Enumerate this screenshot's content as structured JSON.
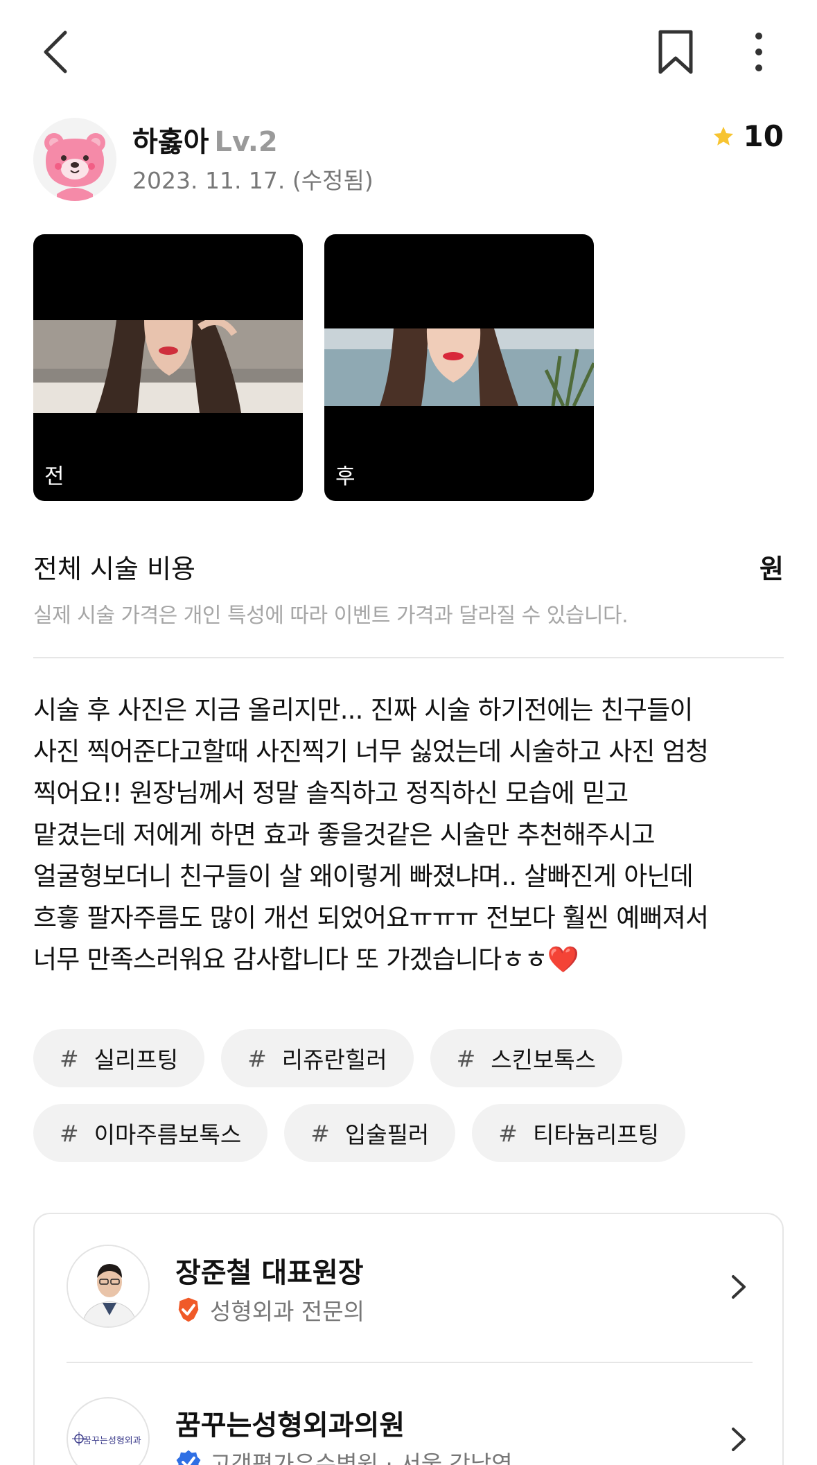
{
  "author": {
    "name": "하홇아",
    "level": "Lv.2",
    "date": "2023. 11. 17. (수정됨)",
    "rating": "10"
  },
  "photos": {
    "before_label": "전",
    "after_label": "후"
  },
  "cost": {
    "title": "전체 시술 비용",
    "unit": "원",
    "note": "실제 시술 가격은 개인 특성에 따라 이벤트 가격과 달라질 수 있습니다."
  },
  "review": {
    "lines": [
      "시술 후 사진은 지금 올리지만... 진짜 시술 하기전에는 친구들이",
      "사진 찍어준다고할때 사진찍기 너무 싫었는데 시술하고 사진 엄청",
      "찍어요!! 원장님께서 정말 솔직하고 정직하신 모습에 믿고",
      "맡겼는데 저에게 하면 효과 좋을것같은 시술만 추천해주시고",
      "얼굴형보더니 친구들이 살 왜이렇게 빠졌냐며.. 살빠진게 아닌데",
      "흐흫 팔자주름도 많이 개선 되었어요ㅠㅠㅠ 전보다 훨씬 예뻐져서",
      "너무 만족스러워요 감사합니다 또 가겠습니다ㅎㅎ"
    ],
    "emoji": "❤️"
  },
  "tags": {
    "hash": "#",
    "row1": [
      "실리프팅",
      "리쥬란힐러",
      "스킨보톡스"
    ],
    "row2": [
      "이마주름보톡스",
      "입술필러",
      "티타늄리프팅"
    ]
  },
  "doctor": {
    "name": "장준철 대표원장",
    "specialty": "성형외과 전문의"
  },
  "clinic": {
    "name": "꿈꾸는성형외과의원",
    "sub": "고객평가우수병원 · 서울 강남역",
    "logo_text": "꿈꾸는성형외과"
  },
  "colors": {
    "star": "#f7c431",
    "badge": "#f05a28",
    "verified": "#2f6fe4",
    "heart": "#e0222a"
  },
  "icons": {
    "back": "back-arrow-icon",
    "bookmark": "bookmark-icon",
    "more": "more-vertical-icon",
    "star": "star-icon",
    "chevron": "chevron-right-icon"
  }
}
